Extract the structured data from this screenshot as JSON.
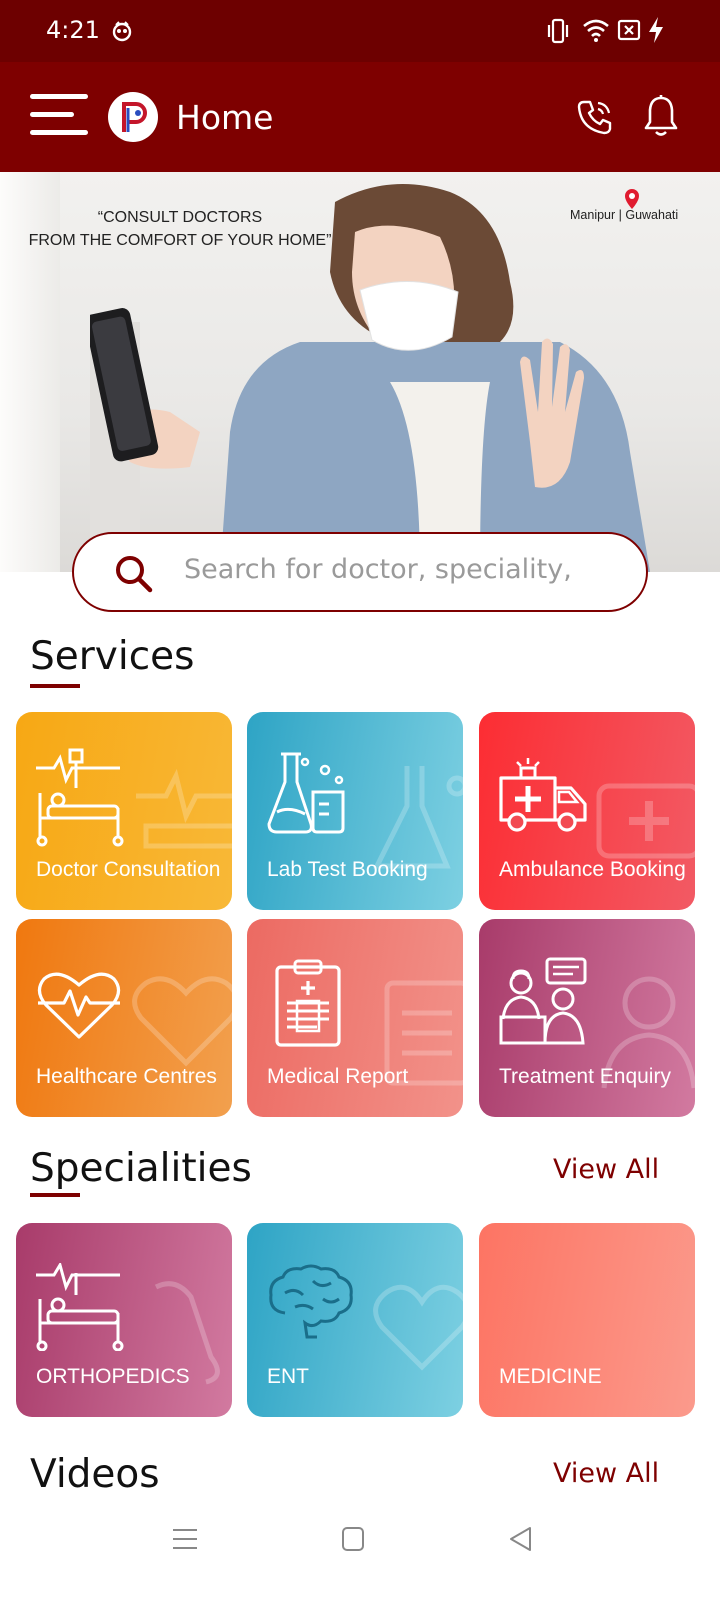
{
  "status_bar": {
    "time": "4:21",
    "icons": [
      "notification-icon",
      "vibrate-icon",
      "wifi-icon",
      "no-sim-icon",
      "charging-icon"
    ]
  },
  "app_bar": {
    "title": "Home",
    "icons": [
      "menu-icon",
      "app-logo",
      "phone-icon",
      "bell-icon"
    ]
  },
  "hero": {
    "quote_line1": "“CONSULT DOCTORS",
    "quote_line2": "FROM THE COMFORT OF YOUR HOME”",
    "location": "Manipur | Guwahati"
  },
  "search": {
    "placeholder": "Search for doctor, speciality,"
  },
  "services": {
    "title": "Services",
    "items": [
      {
        "label": "Doctor Consultation",
        "icon": "hospital-bed-icon"
      },
      {
        "label": "Lab Test Booking",
        "icon": "lab-flask-icon"
      },
      {
        "label": "Ambulance Booking",
        "icon": "ambulance-icon"
      },
      {
        "label": "Healthcare Centres",
        "icon": "heartbeat-icon"
      },
      {
        "label": "Medical Report",
        "icon": "clipboard-report-icon"
      },
      {
        "label": "Treatment Enquiry",
        "icon": "doctor-consult-icon"
      }
    ]
  },
  "specialities": {
    "title": "Specialities",
    "view_all": "View All",
    "items": [
      {
        "label": "ORTHOPEDICS",
        "icon": "hospital-bed-icon"
      },
      {
        "label": "ENT",
        "icon": "brain-icon"
      },
      {
        "label": "MEDICINE",
        "icon": ""
      }
    ]
  },
  "videos": {
    "title": "Videos",
    "view_all": "View All"
  },
  "colors": {
    "brand": "#7e0000",
    "status_bar": "#6d0000"
  }
}
